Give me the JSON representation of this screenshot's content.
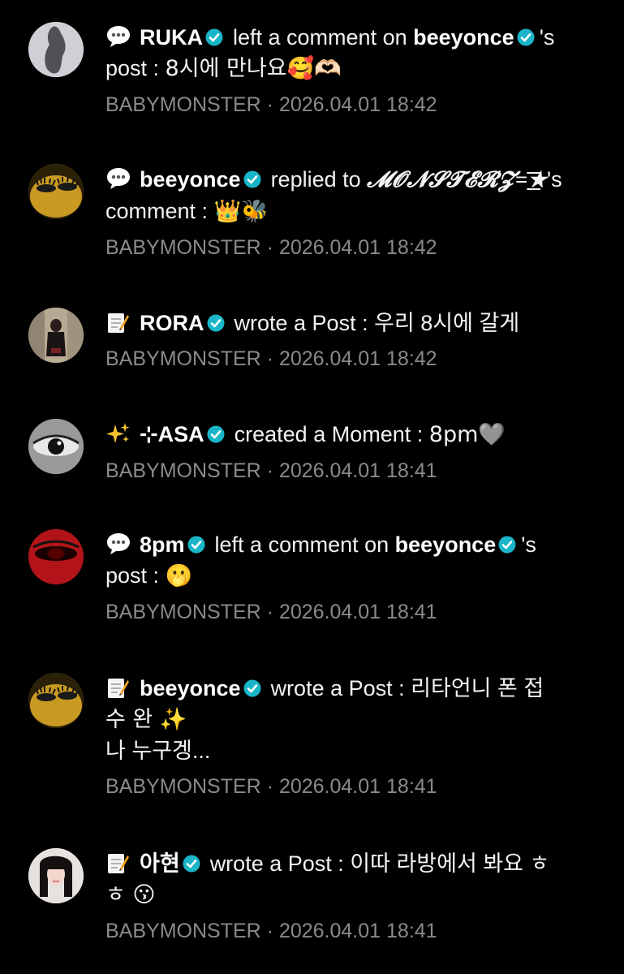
{
  "colors": {
    "background": "#000000",
    "text": "#f2f2f2",
    "meta": "#8a8a8a",
    "verified": "#1ab5c8"
  },
  "feed": [
    {
      "icon": "speech-bubble-icon",
      "avatar": "silhouette",
      "user": "RUKA",
      "verb": "left a comment on",
      "target": "beeyonce",
      "suffix": "'s",
      "body_prefix": "post : ",
      "body_text": "8시에 만나요🥰🫶🏻",
      "source": "BABYMONSTER",
      "time": "2026.04.01 18:42"
    },
    {
      "icon": "speech-bubble-icon",
      "avatar": "gold-lashes",
      "user": "beeyonce",
      "verb": "replied to",
      "target": "𝓜𝓞𝓝𝓢𝓣𝓔𝓡𝓩=͟͟͞͞★",
      "suffix": "'s",
      "body_prefix": "comment : ",
      "body_text": "👑🐝",
      "source": "BABYMONSTER",
      "time": "2026.04.01 18:42"
    },
    {
      "icon": "memo-icon",
      "avatar": "photo-girl",
      "user": "RORA",
      "verb": "wrote a Post :",
      "body_text": "우리 8시에 갈게",
      "source": "BABYMONSTER",
      "time": "2026.04.01 18:42"
    },
    {
      "icon": "sparkles-icon",
      "avatar": "eye-bw",
      "user": "⊹ASA",
      "verb": "created a Moment :",
      "body_text": "8pm🩶",
      "source": "BABYMONSTER",
      "time": "2026.04.01 18:41"
    },
    {
      "icon": "speech-bubble-icon",
      "avatar": "red-eye",
      "user": "8pm",
      "verb": "left a comment on",
      "target": "beeyonce",
      "suffix": "'s",
      "body_prefix": "post : ",
      "body_text": "🫢",
      "source": "BABYMONSTER",
      "time": "2026.04.01 18:41"
    },
    {
      "icon": "memo-icon",
      "avatar": "gold-lashes",
      "user": "beeyonce",
      "verb": "wrote a Post :",
      "body_text": "리타언니 폰 접",
      "body_line2": "수 완 ✨",
      "body_line3": "나 누구겡...",
      "source": "BABYMONSTER",
      "time": "2026.04.01 18:41"
    },
    {
      "icon": "memo-icon",
      "avatar": "portrait",
      "user": "아현",
      "verb": "wrote a Post :",
      "body_text": "이따 라방에서 봐요 ㅎ",
      "body_line2": "ㅎ 😗",
      "source": "BABYMONSTER",
      "time": "2026.04.01 18:41"
    }
  ],
  "separator": "·"
}
